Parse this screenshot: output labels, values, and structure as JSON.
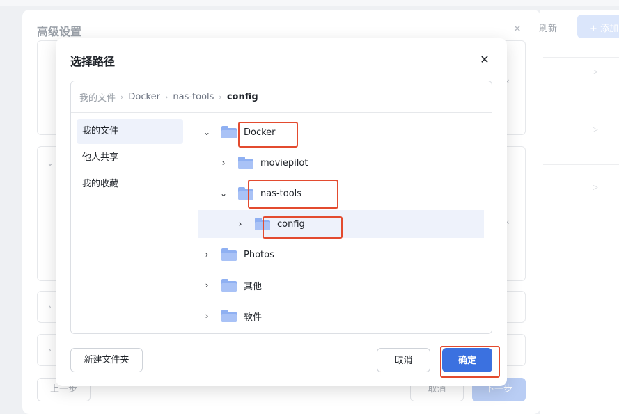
{
  "background": {
    "panel_title": "高级设置",
    "refresh_label": "刷新",
    "add_label": "+ 添加",
    "prev_label": "上一步",
    "cancel_label": "取消",
    "next_label": "下一步"
  },
  "dialog": {
    "title": "选择路径",
    "breadcrumb": [
      "我的文件",
      "Docker",
      "nas-tools",
      "config"
    ],
    "sidebar": [
      "我的文件",
      "他人共享",
      "我的收藏"
    ],
    "tree": [
      {
        "label": "Docker",
        "expanded": true,
        "level": 0
      },
      {
        "label": "moviepilot",
        "expanded": false,
        "level": 1
      },
      {
        "label": "nas-tools",
        "expanded": true,
        "level": 1
      },
      {
        "label": "config",
        "expanded": false,
        "level": 2,
        "selected": true
      },
      {
        "label": "Photos",
        "expanded": false,
        "level": 0
      },
      {
        "label": "其他",
        "expanded": false,
        "level": 0
      },
      {
        "label": "软件",
        "expanded": false,
        "level": 0
      }
    ],
    "new_folder_label": "新建文件夹",
    "cancel_label": "取消",
    "confirm_label": "确定"
  },
  "icons": {
    "close": "close-icon",
    "chevron_right": "chevron-right-icon",
    "chevron_down": "chevron-down-icon",
    "folder": "folder-icon"
  },
  "colors": {
    "primary": "#3b71e0",
    "folder": "#8fb0f2",
    "highlight_annotation": "#e34b2f",
    "selected_row": "#eef2fb"
  }
}
